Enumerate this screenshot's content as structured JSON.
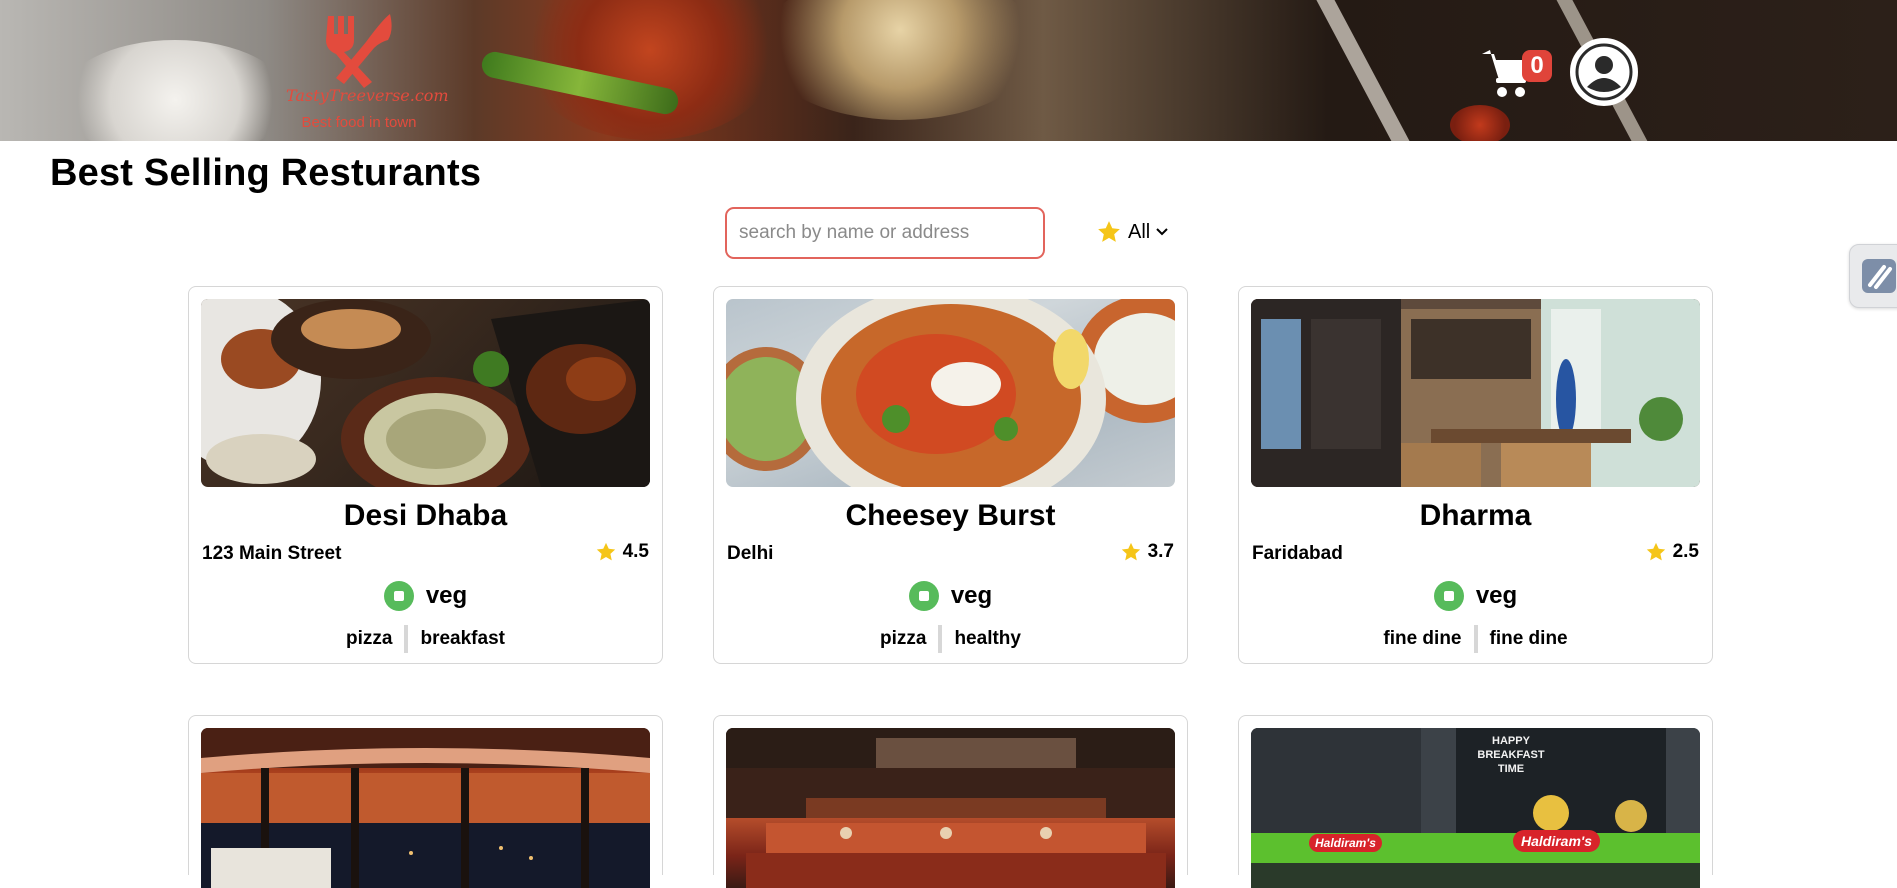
{
  "header": {
    "logo": {
      "brand": "TastyTreeverse.com",
      "tagline": "Best food in town"
    },
    "cart": {
      "count": "0"
    }
  },
  "main": {
    "title": "Best Selling Resturants",
    "search": {
      "placeholder": "search by name or address",
      "value": ""
    },
    "rating_filter": {
      "selected": "All"
    }
  },
  "restaurants": [
    {
      "name": "Desi Dhaba",
      "address": "123 Main Street",
      "rating": "4.5",
      "diet": "veg",
      "tags": [
        "pizza",
        "breakfast"
      ]
    },
    {
      "name": "Cheesey Burst",
      "address": "Delhi",
      "rating": "3.7",
      "diet": "veg",
      "tags": [
        "pizza",
        "healthy"
      ]
    },
    {
      "name": "Dharma",
      "address": "Faridabad",
      "rating": "2.5",
      "diet": "veg",
      "tags": [
        "fine dine",
        "fine dine"
      ]
    }
  ],
  "haldiram_signage": {
    "logo": "Haldiram's",
    "board": "HAPPY BREAKFAST TIME"
  },
  "colors": {
    "accent": "#e34b3d",
    "badge": "#e0443a",
    "veg": "#57bb5b",
    "star": "#f5c518"
  }
}
